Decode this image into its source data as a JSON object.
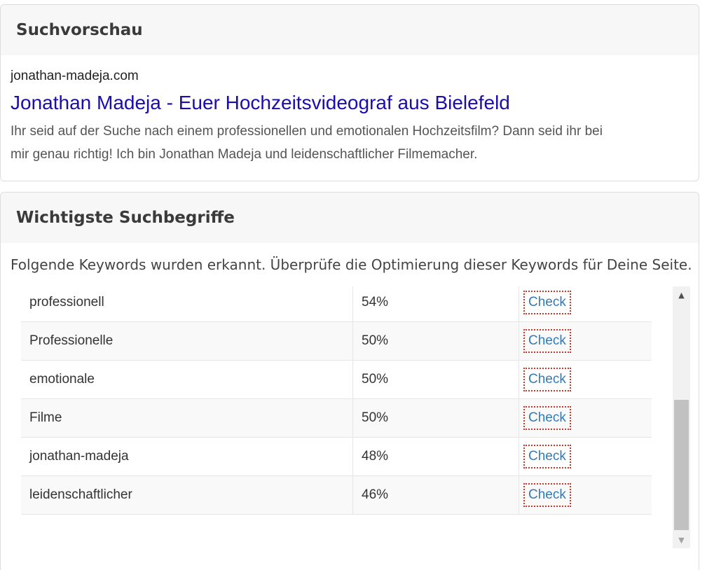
{
  "preview": {
    "heading": "Suchvorschau",
    "url": "jonathan-madeja.com",
    "title": "Jonathan Madeja - Euer Hochzeitsvideograf aus Bielefeld",
    "description": "Ihr seid auf der Suche nach einem professionellen und emotionalen Hochzeitsfilm? Dann seid ihr bei mir genau richtig! Ich bin Jonathan Madeja und leidenschaftlicher Filmemacher."
  },
  "keywords": {
    "heading": "Wichtigste Suchbegriffe",
    "intro": "Folgende Keywords wurden erkannt. Überprüfe die Optimierung dieser Keywords für Deine Seite.",
    "rows": [
      {
        "keyword": "professionell",
        "percent": "54%",
        "action": "Check"
      },
      {
        "keyword": "Professionelle",
        "percent": "50%",
        "action": "Check"
      },
      {
        "keyword": "emotionale",
        "percent": "50%",
        "action": "Check"
      },
      {
        "keyword": "Filme",
        "percent": "50%",
        "action": "Check"
      },
      {
        "keyword": "jonathan-madeja",
        "percent": "48%",
        "action": "Check"
      },
      {
        "keyword": "leidenschaftlicher",
        "percent": "46%",
        "action": "Check"
      }
    ]
  },
  "colors": {
    "link_title": "#1a0dab",
    "check_link": "#337ab7",
    "check_border": "#c0392b"
  },
  "icons": {
    "scroll_up": "triangle-up-icon",
    "scroll_down": "triangle-down-icon"
  }
}
